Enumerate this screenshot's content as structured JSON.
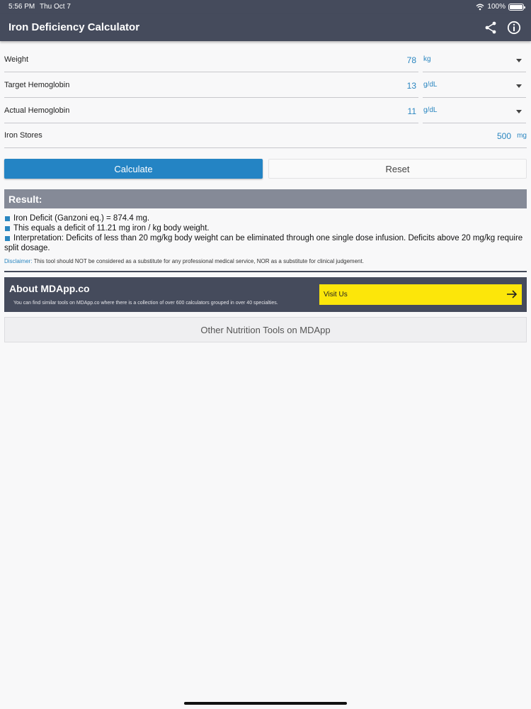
{
  "status_bar": {
    "time": "5:56 PM",
    "date": "Thu Oct 7",
    "battery": "100%"
  },
  "nav": {
    "title": "Iron Deficiency Calculator",
    "share_icon": "share-icon",
    "info_icon": "info-icon"
  },
  "fields": [
    {
      "label": "Weight",
      "value": "78",
      "unit": "kg",
      "has_dropdown": true
    },
    {
      "label": "Target Hemoglobin",
      "value": "13",
      "unit": "g/dL",
      "has_dropdown": true
    },
    {
      "label": "Actual Hemoglobin",
      "value": "11",
      "unit": "g/dL",
      "has_dropdown": true
    },
    {
      "label": "Iron Stores",
      "value": "500",
      "unit": "mg",
      "has_dropdown": false
    }
  ],
  "buttons": {
    "calculate": "Calculate",
    "reset": "Reset"
  },
  "result": {
    "header": "Result:",
    "items": [
      "Iron Deficit (Ganzoni eq.) = 874.4 mg.",
      "This equals a deficit of 11.21 mg iron / kg body weight.",
      "Interpretation: Deficits of less than 20 mg/kg body weight can be eliminated through one single dose infusion. Deficits above 20 mg/kg require split dosage."
    ],
    "disclaimer_label": "Disclaimer:",
    "disclaimer_text": " This tool should NOT be considered as a substitute for any professional medical service, NOR as a substitute for clinical judgement."
  },
  "about": {
    "title": "About MDApp.co",
    "text": "You can find similar tools on MDApp.co where there is a collection of over 600 calculators grouped in over 40 specialties.",
    "visit_label": "Visit Us"
  },
  "other_tools": "Other Nutrition Tools on MDApp",
  "colors": {
    "header_bg": "#454b5c",
    "accent_blue": "#2484c4",
    "visit_yellow": "#fce60a"
  }
}
